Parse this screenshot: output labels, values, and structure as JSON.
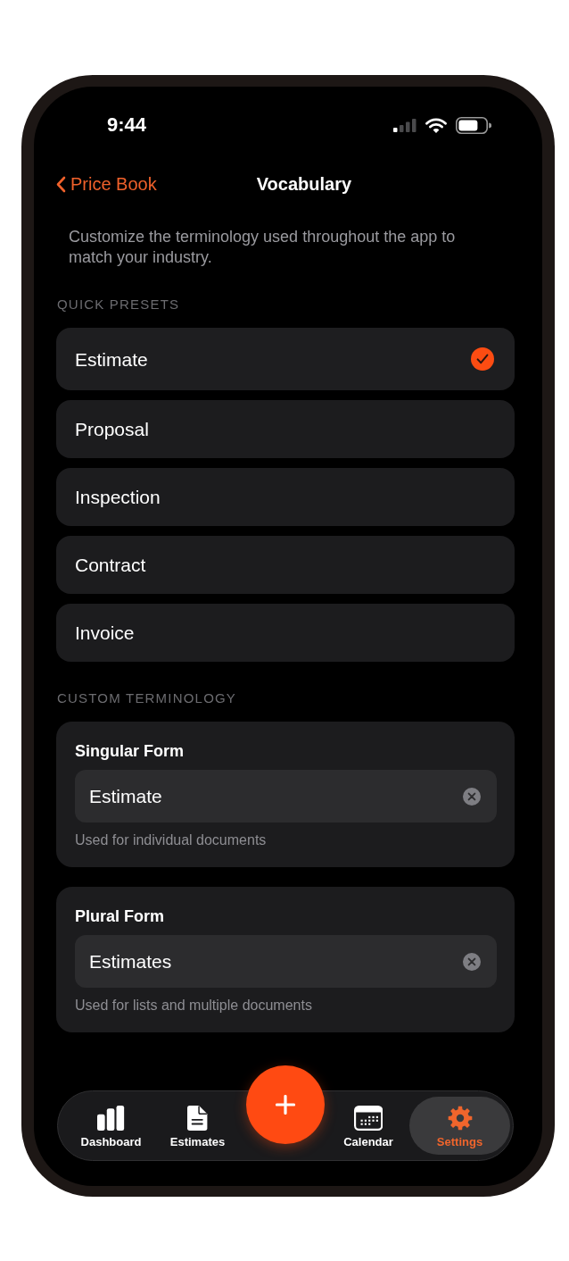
{
  "status_bar": {
    "time": "9:44"
  },
  "nav_bar": {
    "back_label": "Price Book",
    "title": "Vocabulary"
  },
  "description": "Customize the terminology used throughout the app to match your industry.",
  "quick_presets": {
    "heading": "QUICK PRESETS",
    "items": [
      {
        "label": "Estimate",
        "selected": true
      },
      {
        "label": "Proposal",
        "selected": false
      },
      {
        "label": "Inspection",
        "selected": false
      },
      {
        "label": "Contract",
        "selected": false
      },
      {
        "label": "Invoice",
        "selected": false
      }
    ]
  },
  "custom_terminology": {
    "heading": "CUSTOM TERMINOLOGY",
    "fields": [
      {
        "label": "Singular Form",
        "value": "Estimate",
        "helper": "Used for individual documents"
      },
      {
        "label": "Plural Form",
        "value": "Estimates",
        "helper": "Used for lists and multiple documents"
      }
    ]
  },
  "tab_bar": {
    "items": [
      {
        "label": "Dashboard",
        "selected": false
      },
      {
        "label": "Estimates",
        "selected": false
      },
      {
        "label": "Calendar",
        "selected": false
      },
      {
        "label": "Settings",
        "selected": true
      }
    ]
  }
}
